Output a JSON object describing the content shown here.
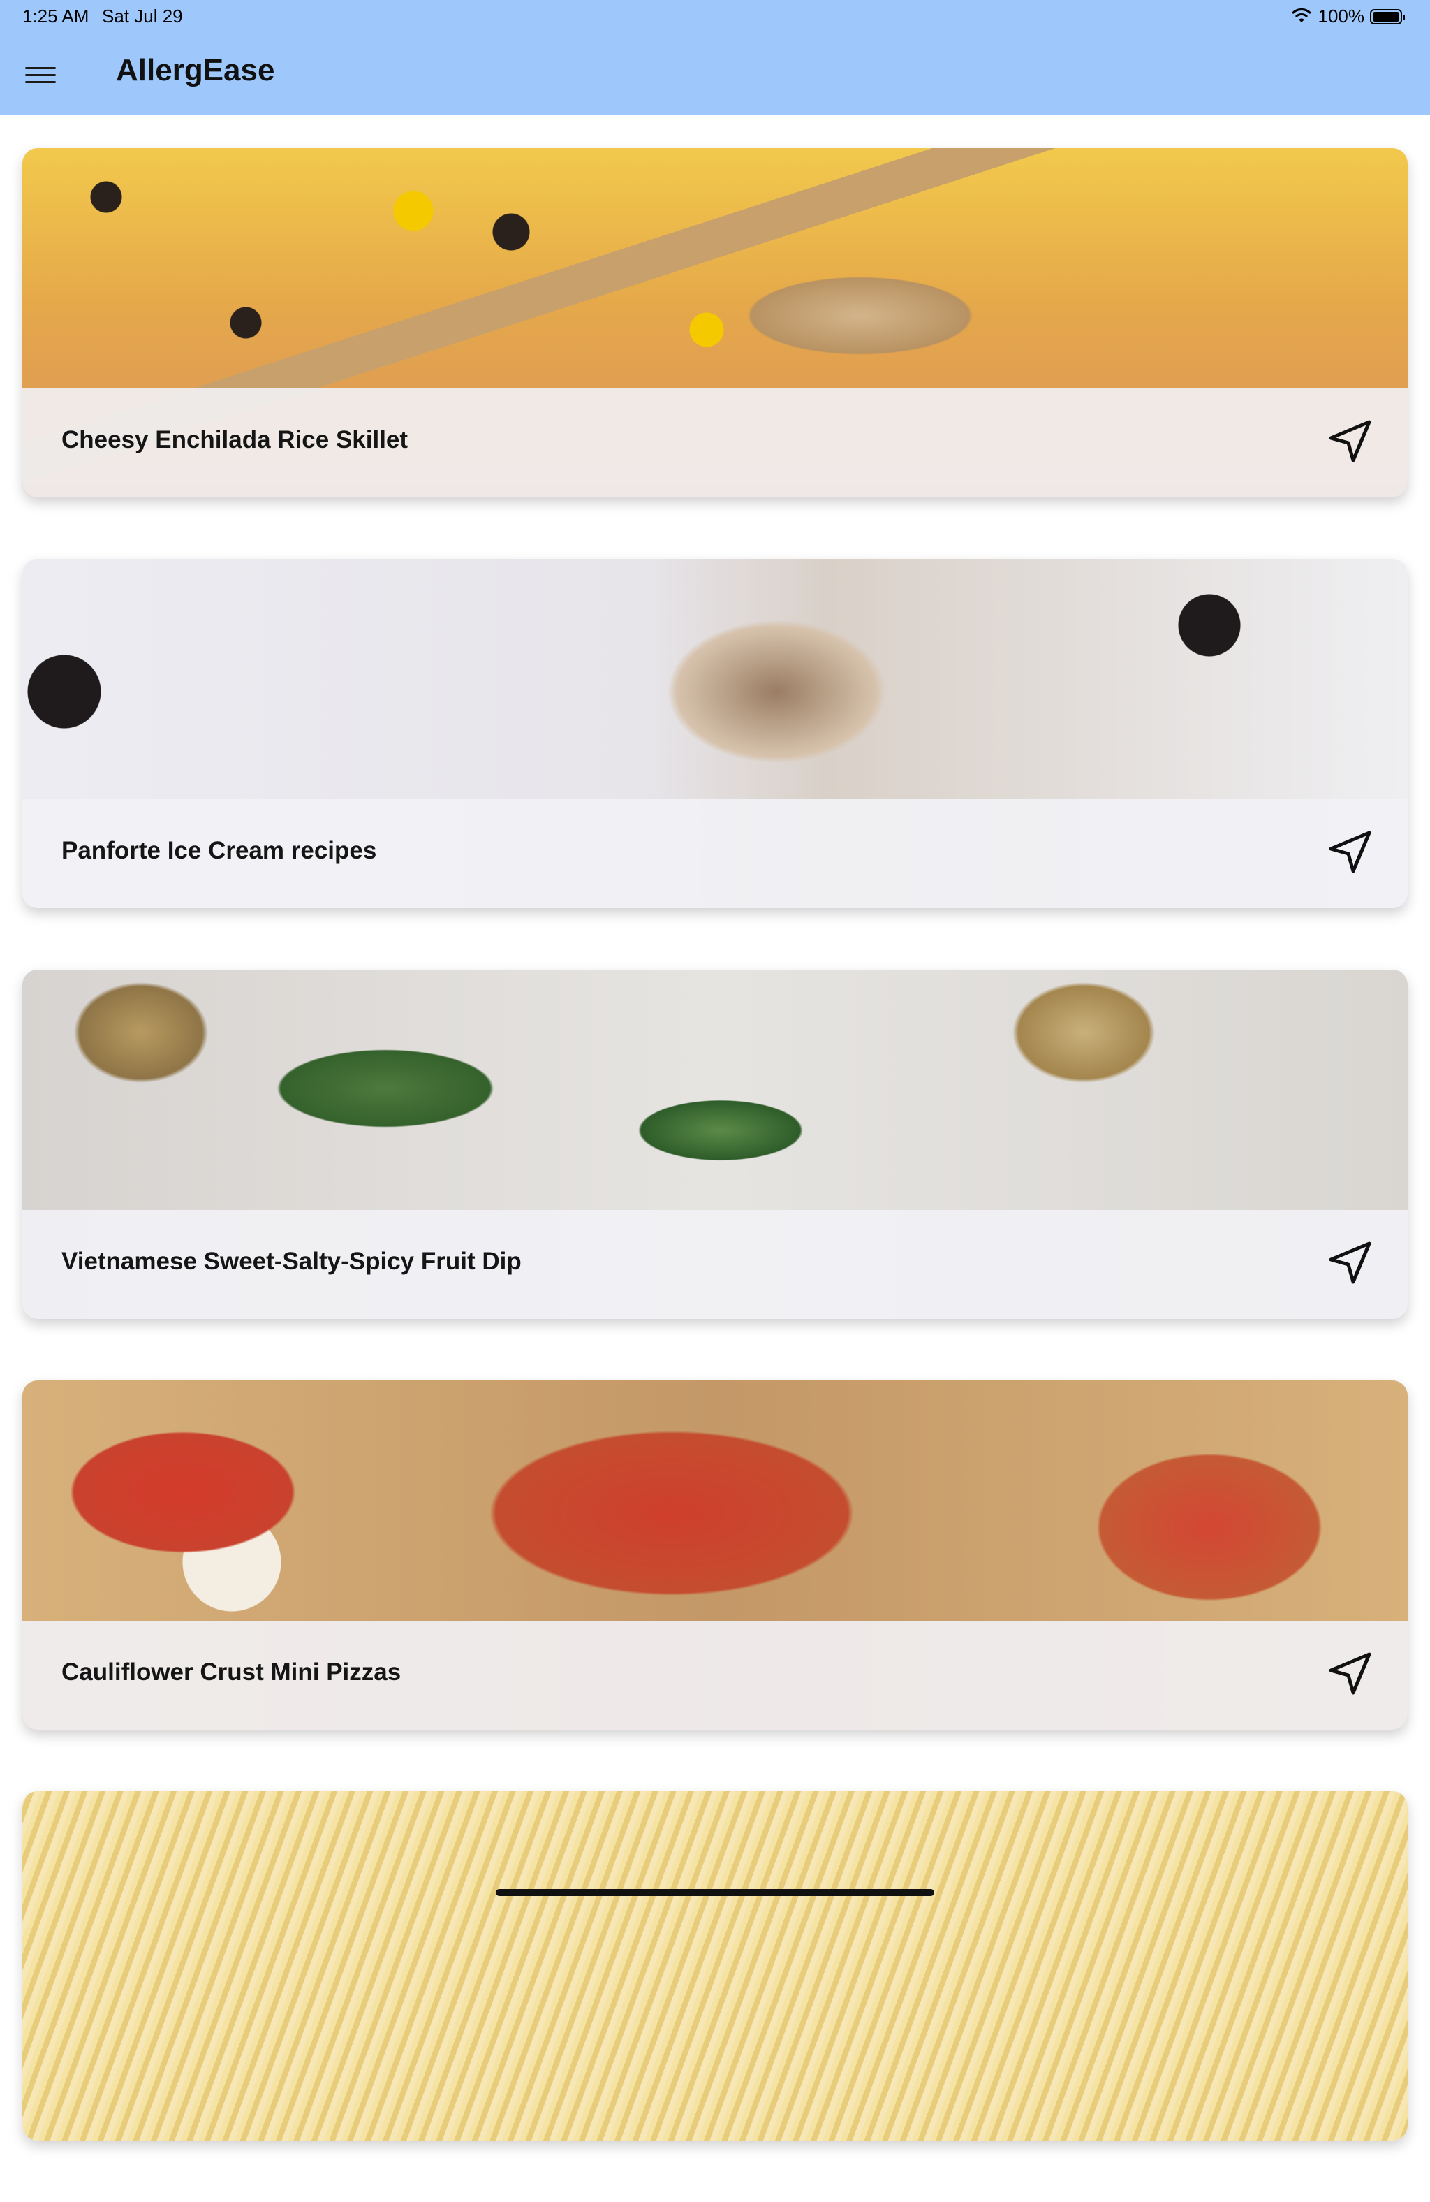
{
  "status_bar": {
    "time": "1:25 AM",
    "date": "Sat Jul 29",
    "battery_percent": "100%",
    "wifi_icon": "wifi-icon",
    "battery_icon": "battery-icon"
  },
  "app_bar": {
    "title": "AllergEase",
    "menu_icon": "hamburger-menu-icon",
    "background_color": "#9ec8fb"
  },
  "cards": [
    {
      "title": "Cheesy Enchilada Rice Skillet",
      "icon": "navigation-arrow-icon"
    },
    {
      "title": "Panforte Ice Cream recipes",
      "icon": "navigation-arrow-icon"
    },
    {
      "title": "Vietnamese Sweet-Salty-Spicy Fruit Dip",
      "icon": "navigation-arrow-icon"
    },
    {
      "title": "Cauliflower Crust Mini Pizzas",
      "icon": "navigation-arrow-icon"
    },
    {
      "title": "",
      "icon": ""
    }
  ]
}
